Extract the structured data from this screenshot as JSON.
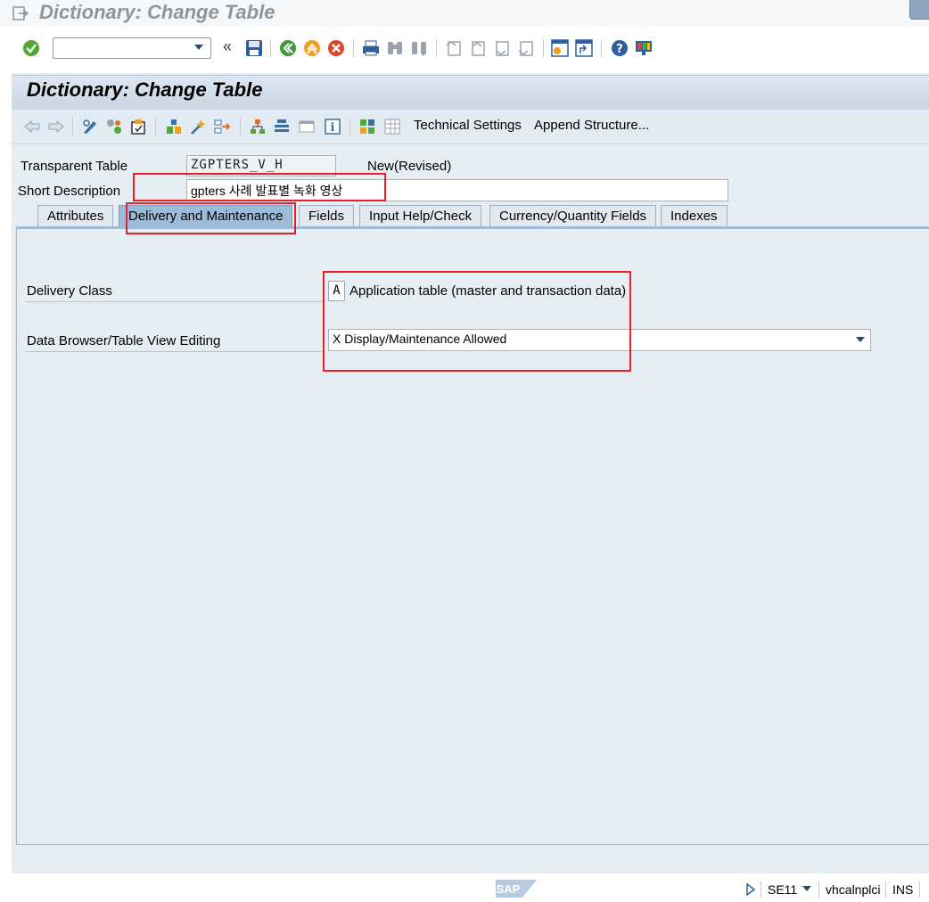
{
  "window": {
    "title": "Dictionary: Change Table"
  },
  "system_toolbar": {
    "command_field": {
      "value": "",
      "placeholder": ""
    },
    "icons": [
      "enter-icon",
      "command-dropdown-icon",
      "collapse-icon",
      "save-icon",
      "back-icon",
      "exit-icon",
      "cancel-icon",
      "print-icon",
      "find-icon",
      "find-next-icon",
      "first-page-icon",
      "previous-page-icon",
      "next-page-icon",
      "last-page-icon",
      "create-session-icon",
      "shortcut-icon",
      "help-icon",
      "customize-layout-icon"
    ]
  },
  "screen": {
    "title": "Dictionary: Change Table"
  },
  "app_toolbar": {
    "technical_settings": "Technical Settings",
    "append_structure": "Append Structure..."
  },
  "header_fields": {
    "transparent_table_label": "Transparent Table",
    "transparent_table_value": "ZGPTERS_V_H",
    "status": "New(Revised)",
    "short_description_label": "Short Description",
    "short_description_value": "gpters 사례 발표별 녹화 영상"
  },
  "tabs": [
    {
      "label": "Attributes",
      "active": false
    },
    {
      "label": "Delivery and Maintenance",
      "active": true
    },
    {
      "label": "Fields",
      "active": false
    },
    {
      "label": "Input Help/Check",
      "active": false
    },
    {
      "label": "Currency/Quantity Fields",
      "active": false
    },
    {
      "label": "Indexes",
      "active": false
    }
  ],
  "delivery_maintenance": {
    "delivery_class_label": "Delivery Class",
    "delivery_class_value": "A",
    "delivery_class_text": "Application table (master and transaction data)",
    "browser_label": "Data Browser/Table View Editing",
    "browser_value": "X Display/Maintenance Allowed"
  },
  "status_bar": {
    "logo": "SAP",
    "transaction": "SE11",
    "server": "vhcalnplci",
    "mode": "INS"
  },
  "colors": {
    "highlight": "#e8202a",
    "active_tab": "#9bbbd9",
    "screen_bg": "#e6edf3"
  }
}
